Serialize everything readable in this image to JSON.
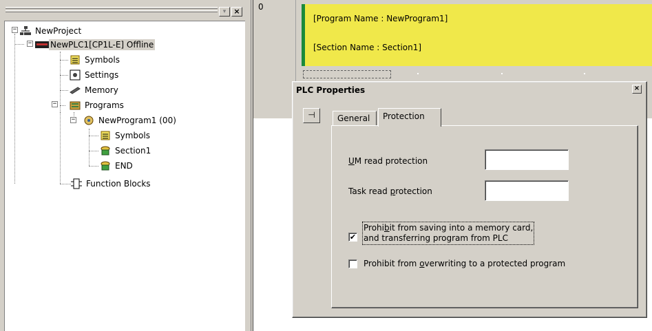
{
  "project_tree": {
    "nodes": [
      {
        "label": "NewProject",
        "icon": "network-icon"
      },
      {
        "label": "NewPLC1[CP1L-E] Offline",
        "icon": "plc-icon"
      },
      {
        "label": "Symbols",
        "icon": "symbols-icon"
      },
      {
        "label": "Settings",
        "icon": "settings-icon"
      },
      {
        "label": "Memory",
        "icon": "memory-icon"
      },
      {
        "label": "Programs",
        "icon": "programs-icon"
      },
      {
        "label": "NewProgram1 (00)",
        "icon": "program-icon"
      },
      {
        "label": "Symbols",
        "icon": "symbols-icon"
      },
      {
        "label": "Section1",
        "icon": "section-icon"
      },
      {
        "label": "END",
        "icon": "section-icon"
      },
      {
        "label": "Function Blocks",
        "icon": "function-blocks-icon"
      }
    ],
    "expander_minus": "−"
  },
  "editor": {
    "rung_number": "0",
    "program_name_line": "[Program Name : NewProgram1]",
    "section_name_line": "[Section Name : Section1]",
    "comment_color": "#f0e84a",
    "rail_color": "#1a8a3a"
  },
  "dialog": {
    "title": "PLC Properties",
    "close_glyph": "×",
    "pin_glyph": "⊣",
    "tabs": [
      {
        "label": "General",
        "active": false
      },
      {
        "label": "Protection",
        "active": true
      }
    ],
    "um_read_protection": {
      "mnemonic": "U",
      "rest": "M read protection",
      "value": ""
    },
    "task_read_protection": {
      "before": "Task read ",
      "mnemonic": "p",
      "after": "rotection",
      "value": ""
    },
    "prohibit_saving": {
      "checked": true,
      "line1_before": "Prohi",
      "mnemonic": "b",
      "line1_after": "it from saving into a memory card,",
      "line2": "and transferring program from PLC"
    },
    "prohibit_overwriting": {
      "checked": false,
      "before": "Prohibit from ",
      "mnemonic": "o",
      "after": "verwriting to a protected program"
    },
    "check_glyph": "✔"
  }
}
